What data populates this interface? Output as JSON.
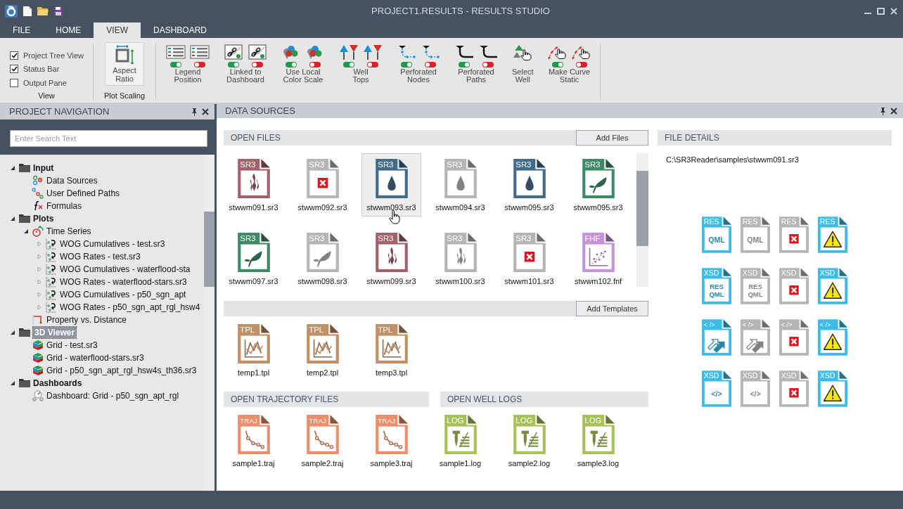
{
  "window": {
    "title": "PROJECT1.RESULTS - RESULTS STUDIO"
  },
  "tabs": [
    {
      "label": "FILE",
      "selected": false
    },
    {
      "label": "HOME",
      "selected": false
    },
    {
      "label": "VIEW",
      "selected": true
    },
    {
      "label": "DASHBOARD",
      "selected": false
    }
  ],
  "ribbon": {
    "view_options": [
      {
        "label": "Project Tree View",
        "checked": true
      },
      {
        "label": "Status Bar",
        "checked": true
      },
      {
        "label": "Output Pane",
        "checked": false
      }
    ],
    "view_group_label": "View",
    "aspect_button": "Aspect\nRatio",
    "scaling_group_label": "Plot Scaling",
    "tools": [
      {
        "label": "Legend\nPosition",
        "kind": "toggle",
        "variants": [
          {
            "on": true
          },
          {
            "on": false
          }
        ]
      },
      {
        "label": "Linked to\nDashboard",
        "kind": "toggle",
        "variants": [
          {
            "on": true
          },
          {
            "on": false
          }
        ]
      },
      {
        "label": "Use Local\nColor Scale",
        "kind": "toggle",
        "variants": [
          {
            "on": true
          },
          {
            "on": false
          }
        ]
      },
      {
        "label": "Well\nTops",
        "kind": "toggle",
        "variants": [
          {
            "on": true
          },
          {
            "on": false
          }
        ]
      },
      {
        "label": "Perforated\nNodes",
        "kind": "toggle",
        "variants": [
          {
            "on": true
          },
          {
            "on": false
          }
        ]
      },
      {
        "label": "Perforated\nPaths",
        "kind": "toggle",
        "variants": [
          {
            "on": true
          },
          {
            "on": false
          }
        ]
      },
      {
        "label": "Select\nWell",
        "kind": "plain"
      },
      {
        "label": "Make Curve\nStatic",
        "kind": "toggle",
        "variants": [
          {
            "on": true
          },
          {
            "on": false
          }
        ]
      }
    ]
  },
  "navigation": {
    "title": "PROJECT NAVIGATION",
    "search": {
      "placeholder": "Enter Search Text"
    },
    "tree": [
      {
        "label": "Input",
        "kind": "folder",
        "expanded": true,
        "selected": false,
        "children": [
          {
            "label": "Data Sources",
            "kind": "datasource",
            "selected": false
          },
          {
            "label": "User Defined Paths",
            "kind": "paths",
            "selected": false
          },
          {
            "label": "Formulas",
            "kind": "formula",
            "selected": false
          }
        ]
      },
      {
        "label": "Plots",
        "kind": "folder",
        "expanded": true,
        "selected": false,
        "children": [
          {
            "label": "Time Series",
            "kind": "timeseries",
            "expanded": true,
            "selected": false,
            "children": [
              {
                "label": "WOG Cumulatives - test.sr3",
                "kind": "plot",
                "expanded": false,
                "selected": false
              },
              {
                "label": "WOG Rates - test.sr3",
                "kind": "plot",
                "expanded": false,
                "selected": false
              },
              {
                "label": "WOG Cumulatives - waterflood-sta",
                "kind": "plot",
                "expanded": false,
                "selected": false
              },
              {
                "label": "WOG Rates - waterflood-stars.sr3",
                "kind": "plot",
                "expanded": false,
                "selected": false
              },
              {
                "label": "WOG Cumulatives - p50_sgn_apt",
                "kind": "plot",
                "expanded": false,
                "selected": false
              },
              {
                "label": "WOG Rates - p50_sgn_apt_rgl_hsw4",
                "kind": "plot",
                "expanded": false,
                "selected": false
              }
            ]
          },
          {
            "label": "Property vs. Distance",
            "kind": "property",
            "selected": false
          }
        ]
      },
      {
        "label": "3D Viewer",
        "kind": "folder",
        "expanded": true,
        "selected": true,
        "children": [
          {
            "label": "Grid - test.sr3",
            "kind": "grid",
            "selected": false
          },
          {
            "label": "Grid - waterflood-stars.sr3",
            "kind": "grid",
            "selected": false
          },
          {
            "label": "Grid - p50_sgn_apt_rgl_hsw4s_th36.sr3",
            "kind": "grid",
            "selected": false
          }
        ]
      },
      {
        "label": "Dashboards",
        "kind": "folder",
        "expanded": true,
        "selected": false,
        "children": [
          {
            "label": "Dashboard: Grid - p50_sgn_apt_rgl",
            "kind": "dashboard",
            "selected": false
          }
        ]
      }
    ]
  },
  "data_sources": {
    "title": "DATA SOURCES",
    "open_files": {
      "title": "OPEN FILES",
      "button": "Add Files",
      "files": [
        {
          "name": "stwwm091.sr3",
          "tag": "SR3",
          "kind": "flame",
          "color": "#a3626b",
          "selected": false
        },
        {
          "name": "stwwm092.sr3",
          "tag": "SR3",
          "kind": "error",
          "color": "#b5b5b5",
          "selected": false
        },
        {
          "name": "stwwm093.sr3",
          "tag": "SR3",
          "kind": "drop",
          "color": "#456b8c",
          "selected": true
        },
        {
          "name": "stwwm094.sr3",
          "tag": "SR3",
          "kind": "drop",
          "color": "#b5b5b5",
          "selected": false
        },
        {
          "name": "stwwm095.sr3",
          "tag": "SR3",
          "kind": "drop",
          "color": "#456b8c",
          "selected": false
        },
        {
          "name": "stwwm095.sr3",
          "tag": "SR3",
          "kind": "leaf",
          "color": "#3f8a66",
          "selected": false
        },
        {
          "name": "stwwm097.sr3",
          "tag": "SR3",
          "kind": "leaf",
          "color": "#3f8a66",
          "selected": false
        },
        {
          "name": "stwwm098.sr3",
          "tag": "SR3",
          "kind": "leaf",
          "color": "#b5b5b5",
          "selected": false
        },
        {
          "name": "stwwm099.sr3",
          "tag": "SR3",
          "kind": "flame",
          "color": "#a3626b",
          "selected": false
        },
        {
          "name": "stwwm100.sr3",
          "tag": "SR3",
          "kind": "flame",
          "color": "#b5b5b5",
          "selected": false
        },
        {
          "name": "stwwm101.sr3",
          "tag": "SR3",
          "kind": "error",
          "color": "#b5b5b5",
          "selected": false
        },
        {
          "name": "stwwm102.fnf",
          "tag": "FHF",
          "kind": "scatter",
          "color": "#c693d8",
          "selected": false
        }
      ]
    },
    "templates": {
      "button": "Add Templates",
      "files": [
        {
          "name": "temp1.tpl",
          "tag": "TPL",
          "kind": "chart",
          "color": "#c19066",
          "selected": false
        },
        {
          "name": "temp2.tpl",
          "tag": "TPL",
          "kind": "chart",
          "color": "#c19066",
          "selected": false
        },
        {
          "name": "temp3.tpl",
          "tag": "TPL",
          "kind": "chart",
          "color": "#c19066",
          "selected": false
        }
      ]
    },
    "trajectory_files": {
      "title": "OPEN TRAJECTORY FILES",
      "files": [
        {
          "name": "sample1.traj",
          "tag": "TRAJ",
          "kind": "trajectory",
          "color": "#ef8c6a",
          "selected": false
        },
        {
          "name": "sample2.traj",
          "tag": "TRAJ",
          "kind": "trajectory",
          "color": "#ef8c6a",
          "selected": false
        },
        {
          "name": "sample3.traj",
          "tag": "TRAJ",
          "kind": "trajectory",
          "color": "#ef8c6a",
          "selected": false
        }
      ]
    },
    "well_logs": {
      "title": "OPEN WELL LOGS",
      "files": [
        {
          "name": "sample1.log",
          "tag": "LOG",
          "kind": "log",
          "color": "#a6c256",
          "selected": false
        },
        {
          "name": "sample2.log",
          "tag": "LOG",
          "kind": "log",
          "color": "#a6c256",
          "selected": false
        },
        {
          "name": "sample3.log",
          "tag": "LOG",
          "kind": "log",
          "color": "#a6c256",
          "selected": false
        }
      ]
    },
    "file_details": {
      "title": "FILE DETAILS",
      "path": "C:\\SR3Reader\\samples\\stwwm091.sr3",
      "icons": [
        {
          "tag": "RES",
          "kind": "text",
          "inner": [
            "QML"
          ],
          "color": "#3cbce9"
        },
        {
          "tag": "RES",
          "kind": "text",
          "inner": [
            "QML"
          ],
          "color": "#b5b5b5"
        },
        {
          "tag": "RES",
          "kind": "error",
          "color": "#b5b5b5"
        },
        {
          "tag": "RES",
          "kind": "warning",
          "color": "#3cbce9"
        },
        {
          "tag": "XSD",
          "kind": "text",
          "inner": [
            "RES",
            "QML"
          ],
          "color": "#3cbce9"
        },
        {
          "tag": "XSD",
          "kind": "text",
          "inner": [
            "RES",
            "QML"
          ],
          "color": "#b5b5b5"
        },
        {
          "tag": "XSD",
          "kind": "error",
          "color": "#b5b5b5"
        },
        {
          "tag": "XSD",
          "kind": "warning",
          "color": "#3cbce9"
        },
        {
          "tag": "< />",
          "kind": "arrows",
          "color": "#3cbce9"
        },
        {
          "tag": "< />",
          "kind": "arrows",
          "color": "#b5b5b5"
        },
        {
          "tag": "< />",
          "kind": "error",
          "color": "#b5b5b5"
        },
        {
          "tag": "< />",
          "kind": "warning",
          "color": "#3cbce9"
        },
        {
          "tag": "XSD",
          "kind": "text",
          "inner": [
            "</>"
          ],
          "color": "#3cbce9"
        },
        {
          "tag": "XSD",
          "kind": "text",
          "inner": [
            "</>"
          ],
          "color": "#b5b5b5"
        },
        {
          "tag": "XSD",
          "kind": "error",
          "color": "#b5b5b5"
        },
        {
          "tag": "XSD",
          "kind": "warning",
          "color": "#3cbce9"
        }
      ]
    }
  }
}
